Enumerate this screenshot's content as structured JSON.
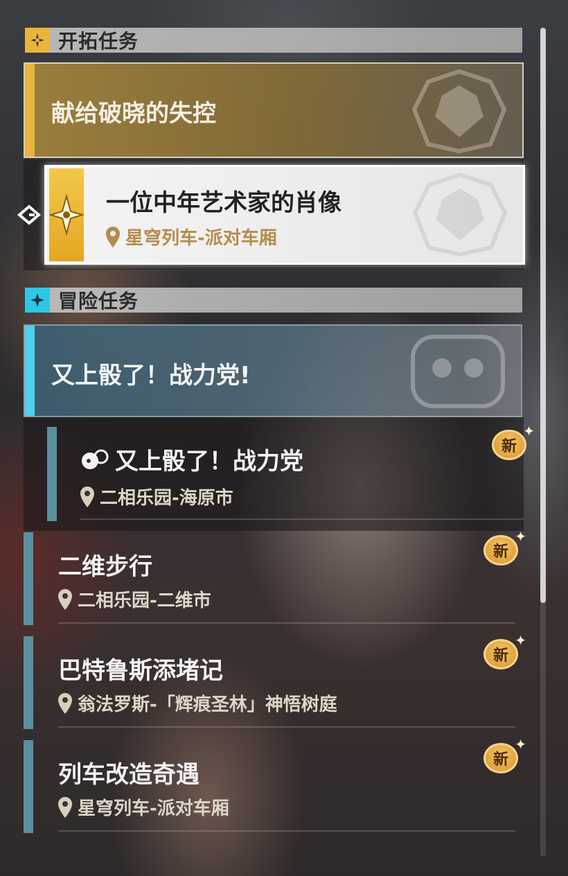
{
  "sections": {
    "trailblaze": {
      "title": "开拓任务"
    },
    "adventure": {
      "title": "冒险任务"
    }
  },
  "trailblaze_quest": {
    "name": "献给破晓的失控",
    "selected_step": {
      "name": "一位中年艺术家的肖像",
      "location": "星穹列车-派对车厢"
    }
  },
  "adventure_quest": {
    "name": "又上骰了！战力党!"
  },
  "quests": [
    {
      "name": "又上骰了！战力党",
      "location": "二相乐园-海原市",
      "badge": "新"
    },
    {
      "name": "二维步行",
      "location": "二相乐园-二维市",
      "badge": "新"
    },
    {
      "name": "巴特鲁斯添堵记",
      "location": "翁法罗斯-「辉痕圣林」神悟树庭",
      "badge": "新"
    },
    {
      "name": "列车改造奇遇",
      "location": "星穹列车-派对车厢",
      "badge": "新"
    }
  ],
  "colors": {
    "trailblaze_accent": "#e9b43d",
    "adventure_accent": "#4fd0ee",
    "location_gold": "#b48c4e",
    "new_badge": "#e3a33c"
  },
  "icons": {
    "trailblaze_badge": "compass-star-icon",
    "adventure_badge": "four-point-star-icon",
    "location": "map-pin-icon",
    "selector": "selector-arrow-icon",
    "dice": "dice-icon"
  }
}
